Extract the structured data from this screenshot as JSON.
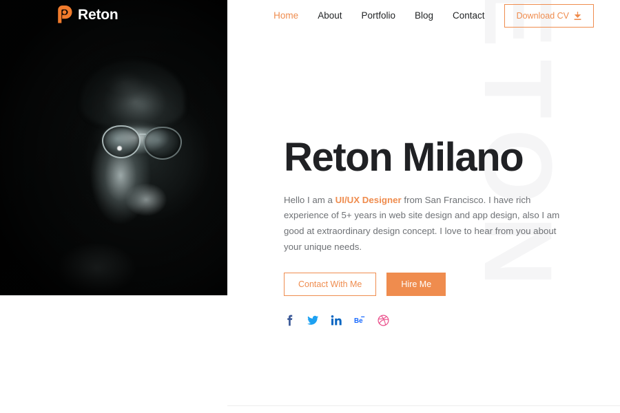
{
  "brand": {
    "name": "Reton",
    "logo_icon": "reton-p-mark-icon",
    "accent_color": "#ef8c4e",
    "logo_text_color": "#ffffff"
  },
  "nav": {
    "items": [
      {
        "label": "Home",
        "active": true
      },
      {
        "label": "About",
        "active": false
      },
      {
        "label": "Portfolio",
        "active": false
      },
      {
        "label": "Blog",
        "active": false
      },
      {
        "label": "Contact",
        "active": false
      }
    ],
    "cta": {
      "label": "Download CV",
      "icon": "download-icon",
      "border_color": "#ef8c4e",
      "text_color": "#ef8c4e"
    }
  },
  "watermark": {
    "text": "RETON",
    "color": "#f5f5f6"
  },
  "portrait": {
    "alt": "dark dramatic portrait of a man wearing round glasses",
    "background_color": "#0b0d0d"
  },
  "hero": {
    "title": "Reton Milano",
    "title_color": "#202124",
    "description_parts": {
      "before": "Hello I am a ",
      "accent": "UI/UX Designer",
      "after": " from San Francisco. I have rich experience of 5+ years in web site design and app design, also I am good at extraordinary design concept. I love to hear from you about your unique needs."
    },
    "buttons": {
      "secondary": {
        "label": "Contact With Me",
        "style": "outline"
      },
      "primary": {
        "label": "Hire Me",
        "style": "solid",
        "fill": "#ef8c4e"
      }
    },
    "socials": [
      {
        "name": "facebook",
        "glyph": "f",
        "color": "#3b5998"
      },
      {
        "name": "twitter",
        "glyph": "bird",
        "color": "#1da1f2"
      },
      {
        "name": "linkedin",
        "glyph": "in",
        "color": "#0a66c2"
      },
      {
        "name": "behance",
        "glyph": "Be",
        "color": "#1769ff"
      },
      {
        "name": "dribbble",
        "glyph": "ball",
        "color": "#ea4c89"
      }
    ]
  }
}
